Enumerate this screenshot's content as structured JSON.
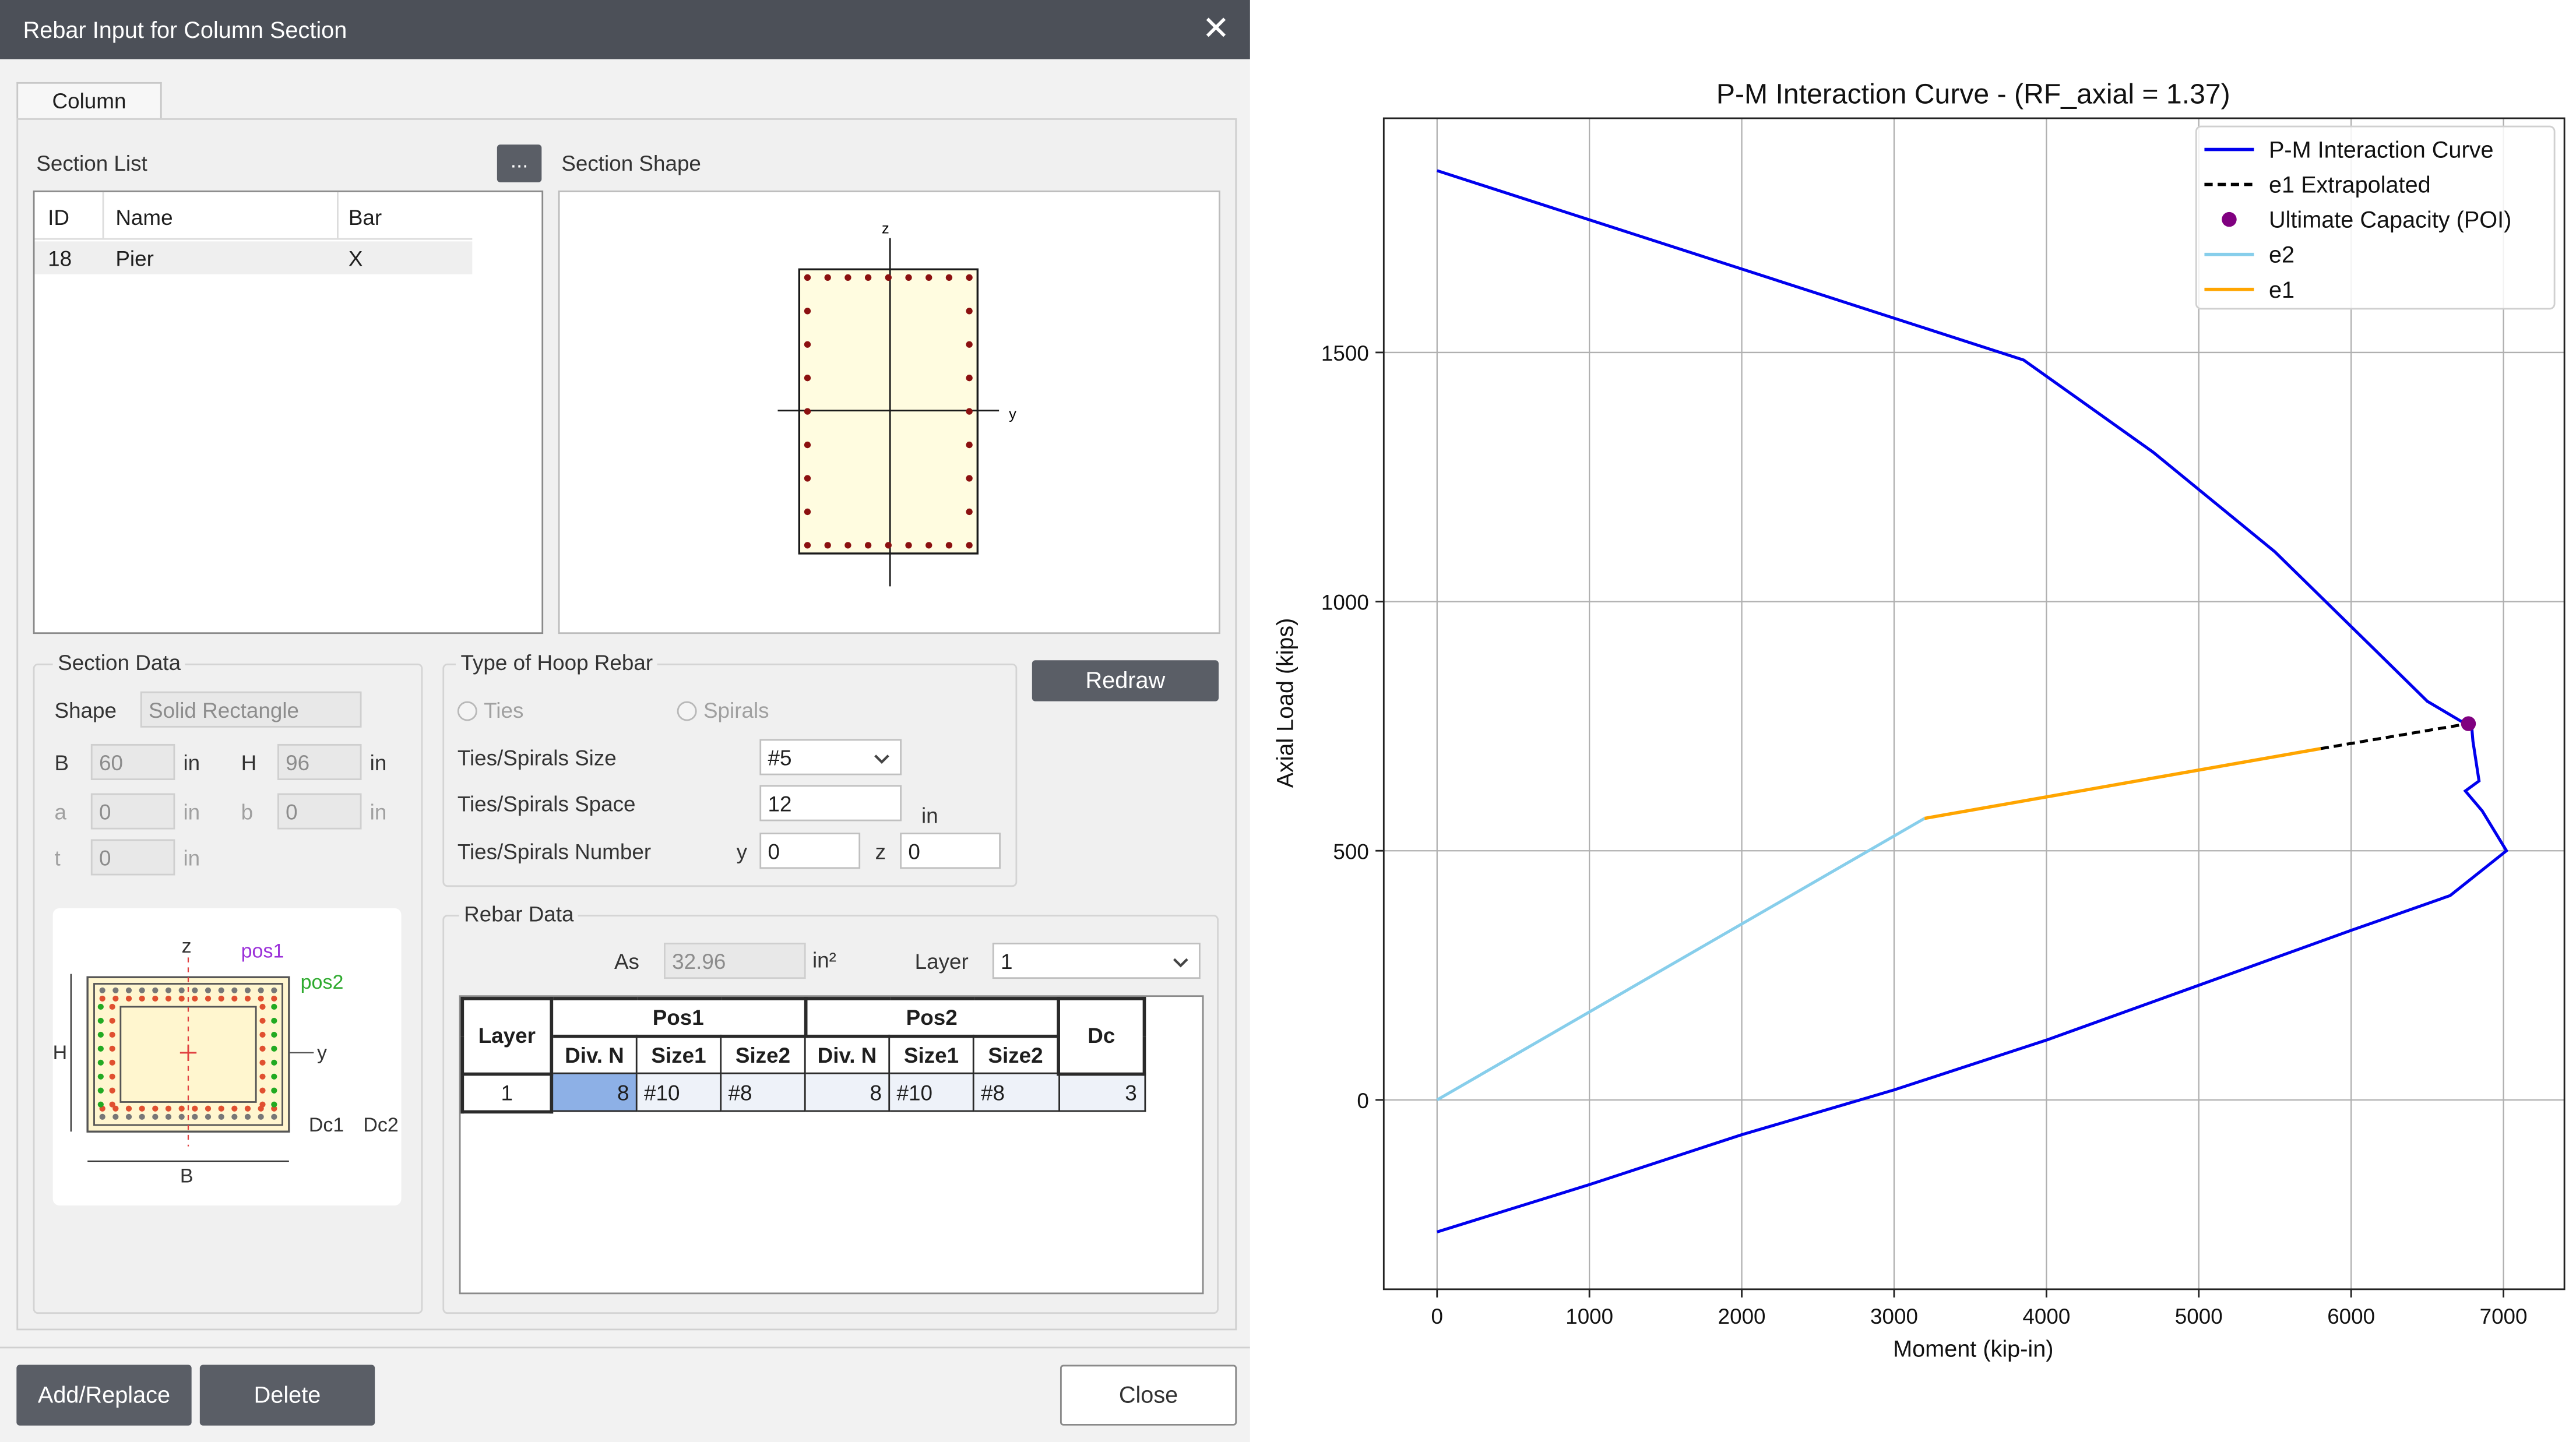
{
  "dialog": {
    "title": "Rebar Input for Column Section",
    "close_glyph": "✕",
    "tab_label": "Column",
    "section_list": {
      "label": "Section List",
      "more_button": "...",
      "columns": [
        "ID",
        "Name",
        "Bar"
      ],
      "rows": [
        {
          "id": "18",
          "name": "Pier",
          "bar": "X"
        }
      ]
    },
    "section_shape": {
      "label": "Section Shape",
      "axis_z": "z",
      "axis_y": "y"
    },
    "section_data": {
      "label": "Section Data",
      "shape_label": "Shape",
      "shape_value": "Solid Rectangle",
      "B_label": "B",
      "B_value": "60",
      "B_unit": "in",
      "H_label": "H",
      "H_value": "96",
      "H_unit": "in",
      "a_label": "a",
      "a_value": "0",
      "a_unit": "in",
      "b_label": "b",
      "b_value": "0",
      "b_unit": "in",
      "t_label": "t",
      "t_value": "0",
      "t_unit": "in"
    },
    "diagram": {
      "z": "z",
      "pos1": "pos1",
      "pos2": "pos2",
      "y": "y",
      "H": "H",
      "B": "B",
      "dc": "Dc1",
      "dc2": "Dc2",
      "colors": {
        "pos1": "#9b30d9",
        "pos2": "#2eaa2e",
        "bars_outer": "#e05030",
        "bars_green": "#22aa22"
      }
    },
    "hoop": {
      "label": "Type of Hoop Rebar",
      "ties_label": "Ties",
      "spirals_label": "Spirals",
      "size_label": "Ties/Spirals Size",
      "size_value": "#5",
      "space_label": "Ties/Spirals Space",
      "space_value": "12",
      "space_unit": "in",
      "number_label": "Ties/Spirals Number",
      "y_label": "y",
      "y_value": "0",
      "z_label": "z",
      "z_value": "0"
    },
    "redraw_button": "Redraw",
    "rebar_data": {
      "label": "Rebar Data",
      "as_label": "As",
      "as_value": "32.96",
      "as_unit": "in²",
      "layer_label": "Layer",
      "layer_value": "1",
      "table": {
        "layer_header": "Layer",
        "pos1_header": "Pos1",
        "pos2_header": "Pos2",
        "dc_header": "Dc",
        "sub_headers": [
          "Div. N",
          "Size1",
          "Size2",
          "Div. N",
          "Size1",
          "Size2"
        ],
        "rows": [
          {
            "layer": "1",
            "p1_divn": "8",
            "p1_size1": "#10",
            "p1_size2": "#8",
            "p2_divn": "8",
            "p2_size1": "#10",
            "p2_size2": "#8",
            "dc": "3"
          }
        ]
      }
    },
    "buttons": {
      "add_replace": "Add/Replace",
      "delete": "Delete",
      "close": "Close"
    }
  },
  "chart_data": {
    "type": "line",
    "title": "P-M Interaction Curve - (RF_axial = 1.37)",
    "xlabel": "Moment (kip-in)",
    "ylabel": "Axial Load (kips)",
    "xlim": [
      -350,
      7400
    ],
    "ylim": [
      -380,
      1970
    ],
    "xticks": [
      0,
      1000,
      2000,
      3000,
      4000,
      5000,
      6000,
      7000
    ],
    "yticks": [
      0,
      500,
      1000,
      1500
    ],
    "grid": true,
    "legend_position": "top-right",
    "series": [
      {
        "name": "P-M Interaction Curve",
        "color": "#0000ee",
        "style": "solid",
        "x": [
          0,
          3850,
          4700,
          5500,
          6100,
          6500,
          6720,
          6790,
          6800,
          6840,
          6750,
          6860,
          7020,
          6650,
          6000,
          5000,
          4000,
          3000,
          2000,
          1000,
          0
        ],
        "y": [
          1865,
          1485,
          1300,
          1100,
          920,
          800,
          760,
          755,
          720,
          640,
          620,
          580,
          500,
          410,
          340,
          230,
          120,
          20,
          -70,
          -170,
          -265
        ]
      },
      {
        "name": "e1 Extrapolated",
        "color": "#000000",
        "style": "dashed",
        "x": [
          5800,
          6770
        ],
        "y": [
          705,
          755
        ]
      },
      {
        "name": "Ultimate Capacity (POI)",
        "color": "#800080",
        "style": "marker",
        "x": [
          6770
        ],
        "y": [
          755
        ]
      },
      {
        "name": "e2",
        "color": "#87ceeb",
        "style": "solid",
        "x": [
          0,
          3200
        ],
        "y": [
          0,
          565
        ]
      },
      {
        "name": "e1",
        "color": "#ffa500",
        "style": "solid",
        "x": [
          3200,
          5800
        ],
        "y": [
          565,
          705
        ]
      }
    ]
  }
}
